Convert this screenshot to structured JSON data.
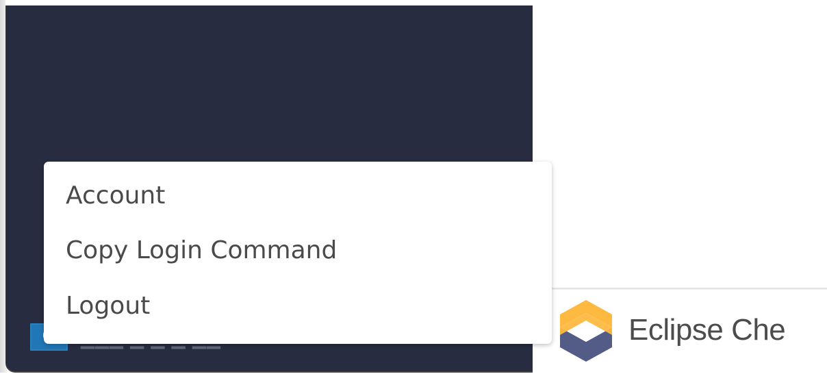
{
  "user_menu": {
    "items": [
      {
        "label": "Account"
      },
      {
        "label": "Copy Login Command"
      },
      {
        "label": "Logout"
      }
    ]
  },
  "footer": {
    "brand_name": "Eclipse Che",
    "brand_icon": "eclipse-che-logo-icon"
  },
  "colors": {
    "sidebar": "#272c40",
    "avatar": "#2077b7",
    "menu_text": "#4a4a4a",
    "brand_text": "#4c4c4c",
    "logo_orange": "#fdb940",
    "logo_navy": "#525c86"
  }
}
